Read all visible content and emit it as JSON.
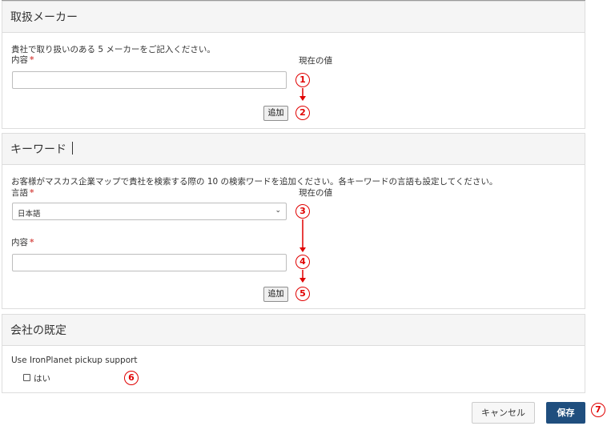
{
  "makers": {
    "title": "取扱メーカー",
    "description": "貴社で取り扱いのある 5 メーカーをご記入ください。",
    "content_label": "内容",
    "required_mark": "*",
    "current_value_label": "現在の値",
    "content_value": "",
    "add_label": "追加",
    "marker_1": "1",
    "marker_2": "2"
  },
  "keywords": {
    "title": "キーワード",
    "description": "お客様がマスカス企業マップで貴社を検索する際の 10 の検索ワードを追加ください。各キーワードの言語も設定してください。",
    "language_label": "言語",
    "required_mark": "*",
    "current_value_label": "現在の値",
    "language_selected": "日本語",
    "content_label": "内容",
    "content_value": "",
    "add_label": "追加",
    "marker_3": "3",
    "marker_4": "4",
    "marker_5": "5"
  },
  "company": {
    "title": "会社の既定",
    "pickup_label": "Use IronPlanet pickup support",
    "checkbox_label": "はい",
    "checkbox_checked": false,
    "marker_6": "6"
  },
  "footer": {
    "cancel_label": "キャンセル",
    "save_label": "保存",
    "marker_7": "7"
  },
  "colors": {
    "annotation_red": "#e00000",
    "save_blue": "#1f4e7e",
    "required_red": "#d9534f",
    "panel_header_bg": "#f5f5f5"
  },
  "icons": {
    "select_caret": "chevron-down-icon",
    "annotation_arrow": "arrow-down-icon"
  }
}
